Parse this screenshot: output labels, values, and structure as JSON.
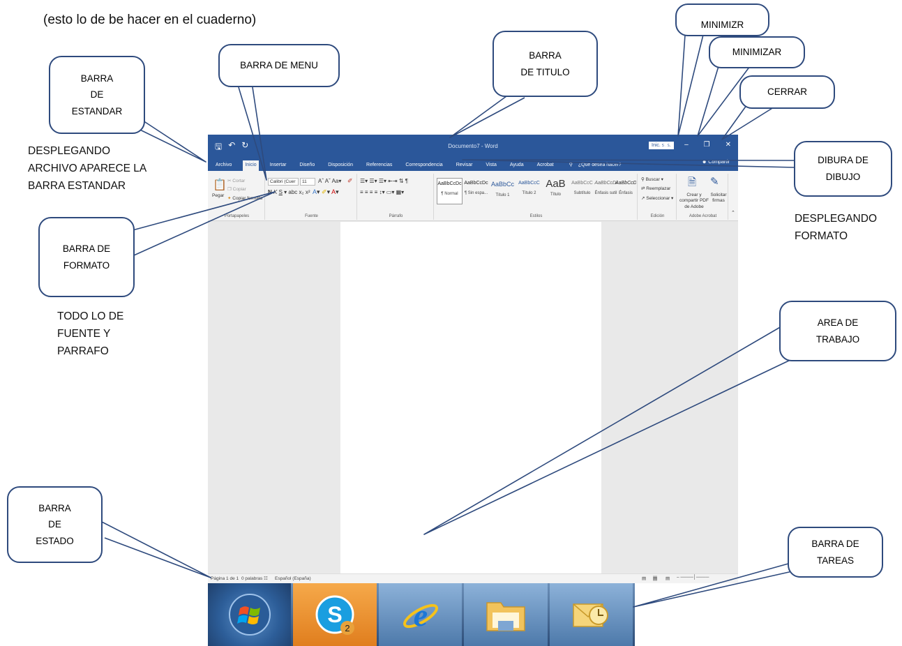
{
  "annotations": {
    "top_note": "(esto lo de be hacer en el cuaderno)",
    "desplegando_archivo": [
      "DESPLEGANDO",
      "ARCHIVO APARECE LA",
      "BARRA ESTANDAR"
    ],
    "todo_fuente": [
      "TODO LO DE",
      "FUENTE Y",
      "PARRAFO"
    ],
    "desplegando_formato": [
      "DESPLEGANDO",
      "FORMATO"
    ]
  },
  "callouts": {
    "barra_estandar": [
      "BARRA",
      "DE",
      "ESTANDAR"
    ],
    "barra_menu": [
      "BARRA DE MENU"
    ],
    "barra_titulo": [
      "BARRA",
      "DE TITULO"
    ],
    "minimizr": [
      "MINIMIZR"
    ],
    "minimizar": [
      "MINIMIZAR"
    ],
    "cerrar": [
      "CERRAR"
    ],
    "dibura_dibujo": [
      "DIBURA DE",
      "DIBUJO"
    ],
    "barra_formato": [
      "BARRA DE",
      "FORMATO"
    ],
    "area_trabajo": [
      "AREA DE",
      "TRABAJO"
    ],
    "barra_estado": [
      "BARRA",
      "DE",
      "ESTADO"
    ],
    "barra_tareas": [
      "BARRA DE",
      "TAREAS"
    ]
  },
  "word": {
    "title": "Documento7 - Word",
    "signin": "Inic. ses.",
    "tabs": [
      "Archivo",
      "Inicio",
      "Insertar",
      "Diseño",
      "Disposición",
      "Referencias",
      "Correspondencia",
      "Revisar",
      "Vista",
      "Ayuda",
      "Acrobat"
    ],
    "tell_me": "¿Qué desea hacer?",
    "share": "Compartir",
    "clipboard": {
      "paste": "Pegar",
      "cut": "Cortar",
      "copy": "Copiar",
      "format_painter": "Copiar formato",
      "label": "Portapapeles"
    },
    "font": {
      "name": "Calibri (Cuer",
      "size": "11",
      "label": "Fuente"
    },
    "paragraph": {
      "label": "Párrafo"
    },
    "styles": {
      "label": "Estilos",
      "items": [
        {
          "sample": "AaBbCcDc",
          "name": "¶ Normal"
        },
        {
          "sample": "AaBbCcDc",
          "name": "¶ Sin espa..."
        },
        {
          "sample": "AaBbCc",
          "name": "Título 1"
        },
        {
          "sample": "AaBbCcC",
          "name": "Título 2"
        },
        {
          "sample": "AaB",
          "name": "Título"
        },
        {
          "sample": "AaBbCcC",
          "name": "Subtítulo"
        },
        {
          "sample": "AaBbCcDi",
          "name": "Énfasis sutil"
        },
        {
          "sample": "AaBbCcDi",
          "name": "Énfasis"
        }
      ]
    },
    "editing": {
      "find": "Buscar",
      "replace": "Reemplazar",
      "select": "Seleccionar",
      "label": "Edición"
    },
    "acrobat": {
      "create": "Crear y compartir PDF de Adobe",
      "sign": "Solicitar firmas",
      "label": "Adobe Acrobat"
    },
    "status": {
      "page": "Página 1 de 1",
      "words": "0 palabras",
      "language": "Español (España)"
    }
  },
  "taskbar": {
    "skype_badge": "2",
    "items": [
      "start-orb-icon",
      "skype-icon",
      "internet-explorer-icon",
      "windows-explorer-icon",
      "outlook-icon"
    ]
  },
  "colors": {
    "word_blue": "#2b579a",
    "callout_border": "#2e4a7d"
  }
}
